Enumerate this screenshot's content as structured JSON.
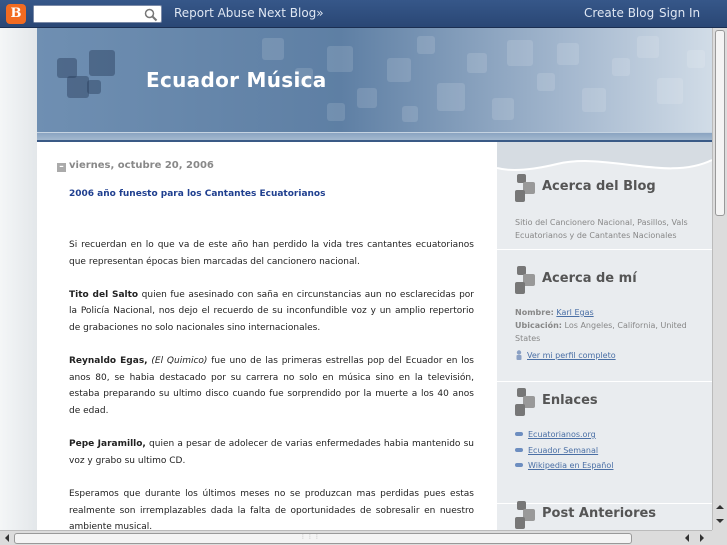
{
  "navbar": {
    "search_placeholder": "",
    "report_abuse": "Report Abuse",
    "next_blog": "Next Blog»",
    "create_blog": "Create Blog",
    "sign_in": "Sign In"
  },
  "header": {
    "title": "Ecuador Música"
  },
  "post": {
    "date": "viernes, octubre 20, 2006",
    "title": "2006 año funesto para los Cantantes Ecuatorianos",
    "p1": "Si recuerdan en lo que va de este año han perdido la vida tres cantantes ecuatorianos que representan épocas bien marcadas del cancionero nacional.",
    "p2_name": "Tito del Salto",
    "p2_text": " quien fue asesinado con saña en circunstancias aun no esclarecidas por la Policía Nacional, nos dejo el recuerdo de su inconfundible voz y un amplio repertorio de grabaciones no solo nacionales sino internacionales.",
    "p3_name": "Reynaldo Egas,",
    "p3_alias": "(El Quimico)",
    "p3_text": " fue uno de las primeras estrellas pop del Ecuador en los anos 80, se habia destacado por su carrera no solo en música sino en la televisión, estaba preparando su ultimo disco cuando fue sorprendido por la muerte a los 40 anos de edad.",
    "p4_name": "Pepe Jaramillo,",
    "p4_text": " quien a pesar de adolecer de varias enfermedades habia mantenido su voz y grabo su ultimo CD.",
    "p5": "Esperamos que durante los últimos meses no se produzcan mas perdidas pues estas realmente son irremplazables dada la falta de oportunidades de sobresalir en nuestro ambiente musical."
  },
  "sidebar": {
    "about_blog_title": "Acerca del Blog",
    "about_blog_text": "Sitio del Cancionero Nacional, Pasillos, Vals Ecuatorianos y de Cantantes Nacionales",
    "about_me_title": "Acerca de mí",
    "name_label": "Nombre:",
    "name_value": "Karl Egas",
    "location_label": "Ubicación:",
    "location_value": "Los Angeles, California, United States",
    "profile_link": "Ver mi perfil completo",
    "links_title": "Enlaces",
    "links": [
      "Ecuatorianos.org",
      "Ecuador Semanal",
      "Wikipedia en Español"
    ],
    "archive_title": "Post Anteriores"
  },
  "colors": {
    "navbar": "#2f4e7f",
    "header": "#6f8fb2",
    "link": "#1f3f8f",
    "sidebar_bg": "#e9ecef",
    "blogger_orange": "#f26b21"
  },
  "icons": [
    "blogger-logo-icon",
    "search-icon",
    "collapse-icon",
    "widget-squares-icon",
    "profile-person-icon",
    "link-bullet-icon",
    "scroll-arrow-icons"
  ]
}
